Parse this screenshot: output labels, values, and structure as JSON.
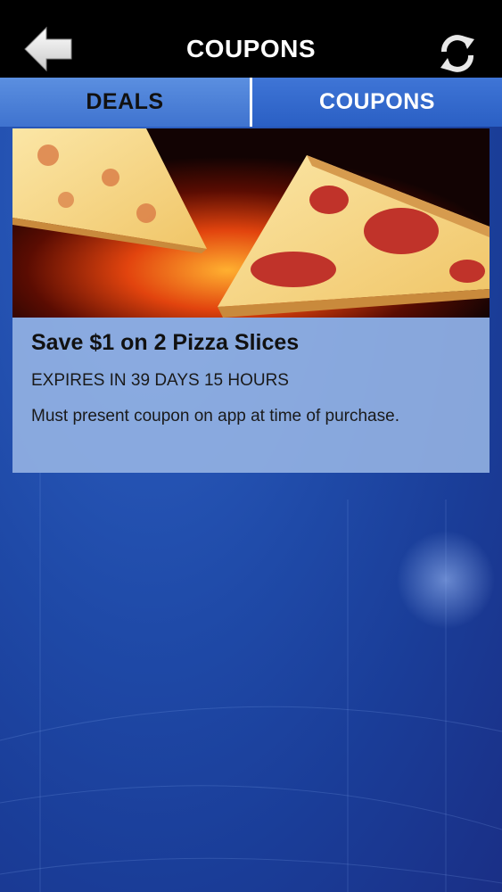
{
  "header": {
    "title": "COUPONS",
    "back_icon": "arrow-left-icon",
    "refresh_icon": "refresh-icon"
  },
  "tabs": [
    {
      "label": "DEALS",
      "active": false
    },
    {
      "label": "COUPONS",
      "active": true
    }
  ],
  "coupons": [
    {
      "image": "pizza-slices-fire",
      "title": "Save $1 on 2 Pizza Slices",
      "expiry": "EXPIRES IN 39 DAYS 15 HOURS",
      "description": "Must present coupon on app at time of purchase."
    }
  ],
  "colors": {
    "header_bg": "#000000",
    "background": "#1f4aa8",
    "tab_active": "#2a5fc4",
    "tab_inactive": "#4f84da",
    "card_bg": "#9bb9e6"
  }
}
